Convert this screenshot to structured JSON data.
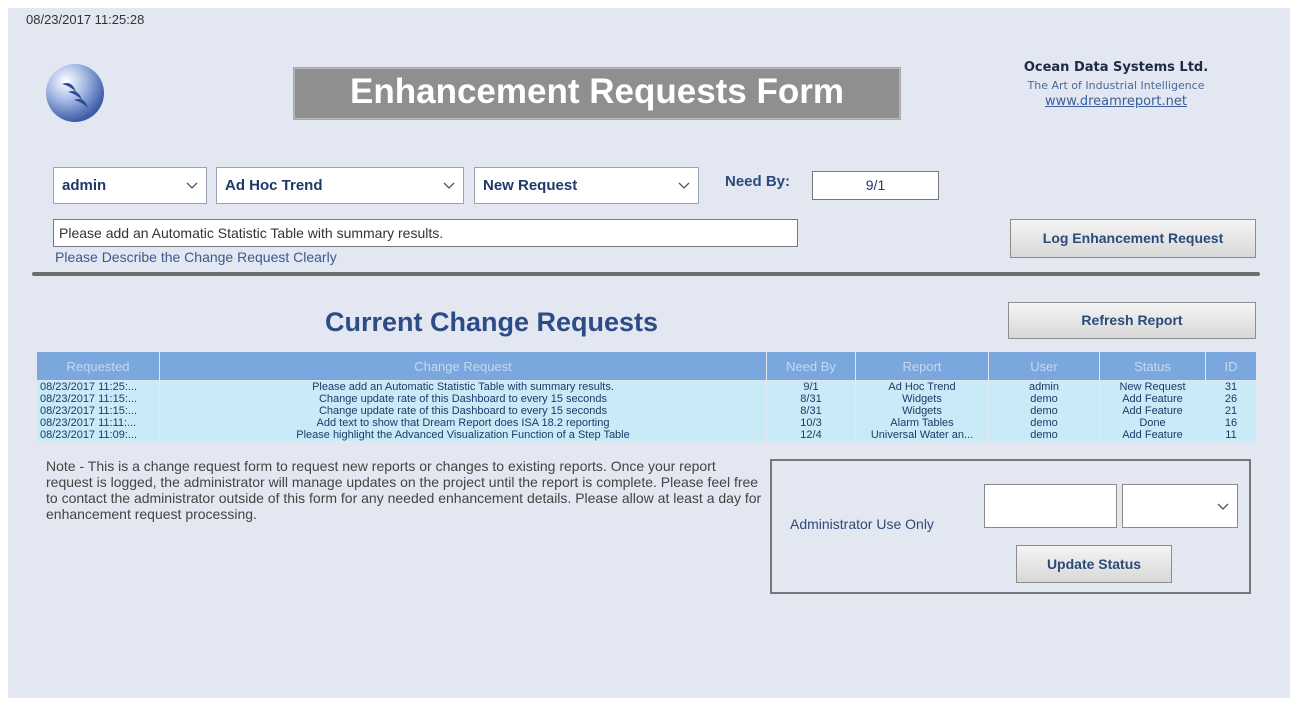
{
  "timestamp": "08/23/2017 11:25:28",
  "title": "Enhancement Requests Form",
  "company": {
    "name": "Ocean Data Systems Ltd.",
    "tagline": "The Art of Industrial Intelligence",
    "url": "www.dreamreport.net"
  },
  "form": {
    "user_select": "admin",
    "report_select": "Ad Hoc Trend",
    "type_select": "New Request",
    "need_by_label": "Need By:",
    "need_by_value": "9/1",
    "description_value": "Please add an Automatic Statistic Table with summary results.",
    "description_hint": "Please Describe the Change Request Clearly",
    "log_button": "Log Enhancement Request"
  },
  "section_title": "Current Change Requests",
  "refresh_button": "Refresh Report",
  "table": {
    "columns": [
      "Requested",
      "Change Request",
      "Need By",
      "Report",
      "User",
      "Status",
      "ID"
    ],
    "rows": [
      [
        "08/23/2017 11:25:...",
        "Please add an Automatic Statistic Table with summary results.",
        "9/1",
        "Ad Hoc Trend",
        "admin",
        "New Request",
        "31"
      ],
      [
        "08/23/2017 11:15:...",
        "Change update rate of this Dashboard to every 15 seconds",
        "8/31",
        "Widgets",
        "demo",
        "Add Feature",
        "26"
      ],
      [
        "08/23/2017 11:15:...",
        "Change update rate of this Dashboard to every 15 seconds",
        "8/31",
        "Widgets",
        "demo",
        "Add Feature",
        "21"
      ],
      [
        "08/23/2017 11:11:...",
        "Add text to show that Dream Report does ISA 18.2 reporting",
        "10/3",
        "Alarm Tables",
        "demo",
        "Done",
        "16"
      ],
      [
        "08/23/2017 11:09:...",
        "Please highlight the Advanced Visualization Function of a Step Table",
        "12/4",
        "Universal Water an...",
        "demo",
        "Add Feature",
        "11"
      ]
    ]
  },
  "note": "Note - This is a change request form to request new reports or changes to existing reports. Once your report request is logged, the administrator will manage updates on the project until the report is complete. Please feel free to contact the administrator outside of this form for any needed enhancement details. Please allow at least a day for enhancement request processing.",
  "admin": {
    "label": "Administrator Use Only",
    "input_value": "",
    "select_value": "",
    "update_button": "Update Status"
  }
}
